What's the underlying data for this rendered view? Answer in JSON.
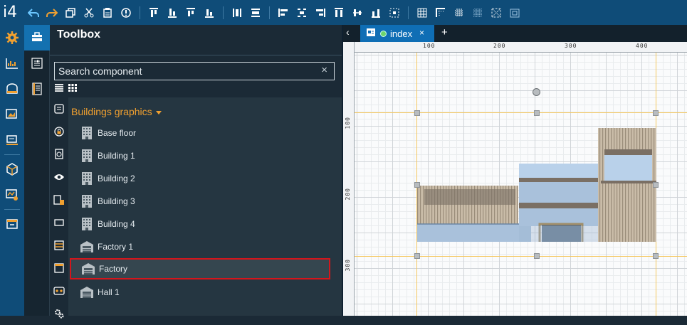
{
  "app": {
    "logo": "i4"
  },
  "toolbar": {
    "icons": [
      "undo-icon",
      "redo-icon",
      "copy-icon",
      "cut-icon",
      "paste-icon",
      "info-icon",
      "align-top-icon",
      "align-bottom-icon",
      "align-middle-icon",
      "distribute-horizontal-icon",
      "distribute-vertical-icon",
      "align-left-icon",
      "align-center-icon",
      "align-right-icon",
      "align-top-edge-icon",
      "align-center-h-icon",
      "align-bottom-edge-icon",
      "center-icon",
      "grid-icon",
      "grid-corner-icon",
      "grid-snap-icon",
      "grid-fine-icon",
      "grid-toggle-icon",
      "group-icon"
    ]
  },
  "leftbar": {
    "items": [
      "settings-icon",
      "chart-icon",
      "database-icon",
      "image-gallery-icon",
      "screens-icon",
      "package-icon",
      "monitor-icon",
      "archive-icon"
    ]
  },
  "toolrail": {
    "items": [
      "toolbox-icon",
      "properties-icon",
      "pages-icon"
    ]
  },
  "toolbox": {
    "title": "Toolbox",
    "search": {
      "placeholder": "Search component",
      "clear_label": "×",
      "value": ""
    },
    "category": "Buildings graphics",
    "items": [
      {
        "label": "Base floor",
        "icon": "building-icon"
      },
      {
        "label": "Building 1",
        "icon": "building-icon"
      },
      {
        "label": "Building 2",
        "icon": "building-icon"
      },
      {
        "label": "Building 3",
        "icon": "building-icon"
      },
      {
        "label": "Building 4",
        "icon": "building-icon"
      },
      {
        "label": "Factory 1",
        "icon": "factory-icon"
      },
      {
        "label": "Factory",
        "icon": "factory-icon",
        "selected": true
      },
      {
        "label": "Hall 1",
        "icon": "factory-icon"
      }
    ]
  },
  "editor": {
    "back_label": "‹",
    "tab": {
      "label": "index",
      "close_label": "×",
      "status_color": "#6dd46d"
    },
    "add_tab_label": "+",
    "ruler_top": [
      "100",
      "200",
      "300",
      "400"
    ],
    "ruler_left": [
      "100",
      "200",
      "300"
    ]
  },
  "colors": {
    "accent": "#1471b0",
    "brand": "#0f4c78",
    "category": "#f0a030",
    "selection": "#d4161c"
  }
}
